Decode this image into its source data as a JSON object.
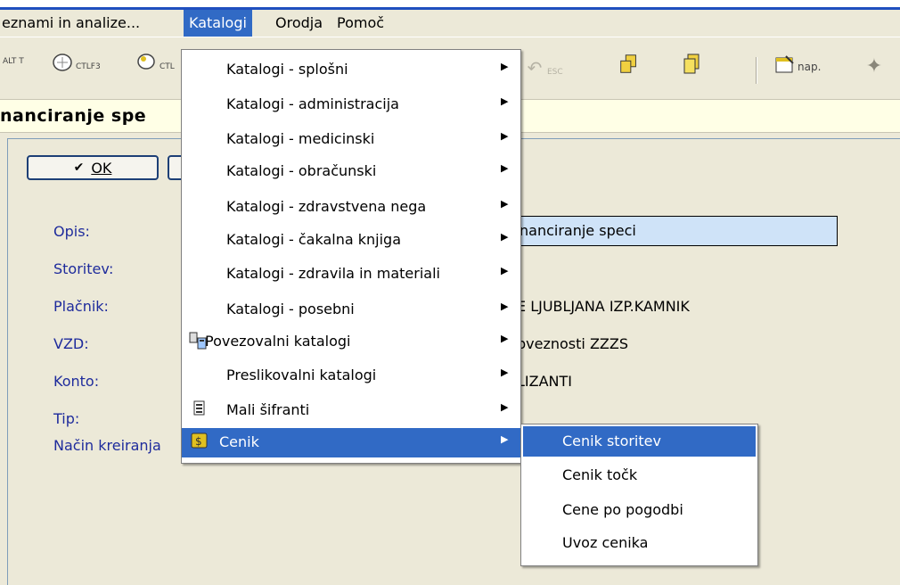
{
  "menubar": {
    "items": [
      {
        "label": "eznami in analize..."
      },
      {
        "label": "Katalogi"
      },
      {
        "label": "Orodja"
      },
      {
        "label": "Pomoč"
      }
    ]
  },
  "toolbar": {
    "alt_t": "ALT T",
    "ctl_f3": "CTLF3",
    "ctl": "CTL",
    "esc": "ESC",
    "nap": "nap."
  },
  "header": {
    "title": "nanciranje spe"
  },
  "buttons": {
    "ok_label": "OK"
  },
  "form": {
    "opis_label": "Opis:",
    "opis_value": "nanciranje speci",
    "storitev_label": "Storitev:",
    "placnik_label": "Plačnik:",
    "placnik_value": "E LJUBLJANA IZP.KAMNIK",
    "vzd_label": "VZD:",
    "vzd_value": "bveznosti ZZZS",
    "konto_label": "Konto:",
    "konto_value": "LIZANTI",
    "tip_label": "Tip:",
    "nacin_label": "Način kreiranja"
  },
  "katalogi_menu": {
    "items": [
      {
        "label": "Katalogi - splošni"
      },
      {
        "label": "Katalogi - administracija"
      },
      {
        "label": "Katalogi - medicinski"
      },
      {
        "label": "Katalogi - obračunski"
      },
      {
        "label": "Katalogi - zdravstvena nega"
      },
      {
        "label": "Katalogi - čakalna knjiga"
      },
      {
        "label": "Katalogi - zdravila in materiali"
      },
      {
        "label": "Katalogi - posebni"
      },
      {
        "label": "Povezovalni katalogi"
      },
      {
        "label": "Preslikovalni katalogi"
      },
      {
        "label": "Mali šifranti"
      },
      {
        "label": "Cenik"
      }
    ]
  },
  "cenik_submenu": {
    "items": [
      {
        "label": "Cenik storitev"
      },
      {
        "label": "Cenik točk"
      },
      {
        "label": "Cene po pogodbi"
      },
      {
        "label": "Uvoz cenika"
      }
    ]
  },
  "colors": {
    "highlight": "#316ac5",
    "label_blue": "#1e2b9c",
    "input_bg": "#cfe3f8",
    "header_band": "#ffffe6"
  }
}
